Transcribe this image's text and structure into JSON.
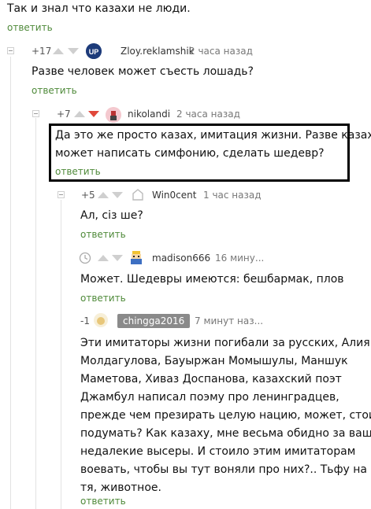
{
  "top_comment": {
    "text": "Так и знал что казахи не люди.",
    "reply_label": "ответить"
  },
  "comments": [
    {
      "score": "+17",
      "username": "Zloy.reklamshik",
      "time": "2 часа назад",
      "text": "Разве человек может съесть лошадь?",
      "reply_label": "ответить"
    },
    {
      "score": "+7",
      "username": "nikolandi",
      "time": "2 часа назад",
      "text_lines": [
        "Да это же просто казах, имитация жизни. Разве казах",
        "может написать симфонию, сделать шедевр?"
      ],
      "reply_label": "ответить"
    },
    {
      "score": "+5",
      "username": "Win0cent",
      "time": "1 час назад",
      "text": "Ал, сіз ше?",
      "reply_label": "ответить"
    },
    {
      "score": "",
      "username": "madison666",
      "time": "16 мину...",
      "text": "Может. Шедевры имеются: бешбармак, плов",
      "reply_label": "ответить"
    },
    {
      "score": "-1",
      "username": "chingga2016",
      "time": "7 минут наз...",
      "text_lines": [
        "Эти имитаторы жизни погибали за русских, Алия",
        "Молдагулова, Бауыржан Момышулы, Маншук",
        "Маметова, Хиваз Доспанова, казахский поэт",
        "Джамбул написал поэму про ленинградцев,",
        "прежде чем презирать целую нацию, может, стоит",
        "подумать? Как казаху, мне весьма обидно за ваши",
        "недалекие высеры. И стоило этим имитаторам",
        "воевать, чтобы вы тут воняли про них?.. Тьфу на",
        "тя, животное."
      ],
      "reply_label": "ответить"
    }
  ],
  "icons": {
    "collapse": "minus-box-icon",
    "upvote": "arrow-up-icon",
    "downvote": "arrow-down-icon",
    "clock": "clock-icon"
  },
  "colors": {
    "reply_link": "#4f8a3a",
    "downvote_active": "#e0483b",
    "badge_bg": "#8a8a8a"
  }
}
